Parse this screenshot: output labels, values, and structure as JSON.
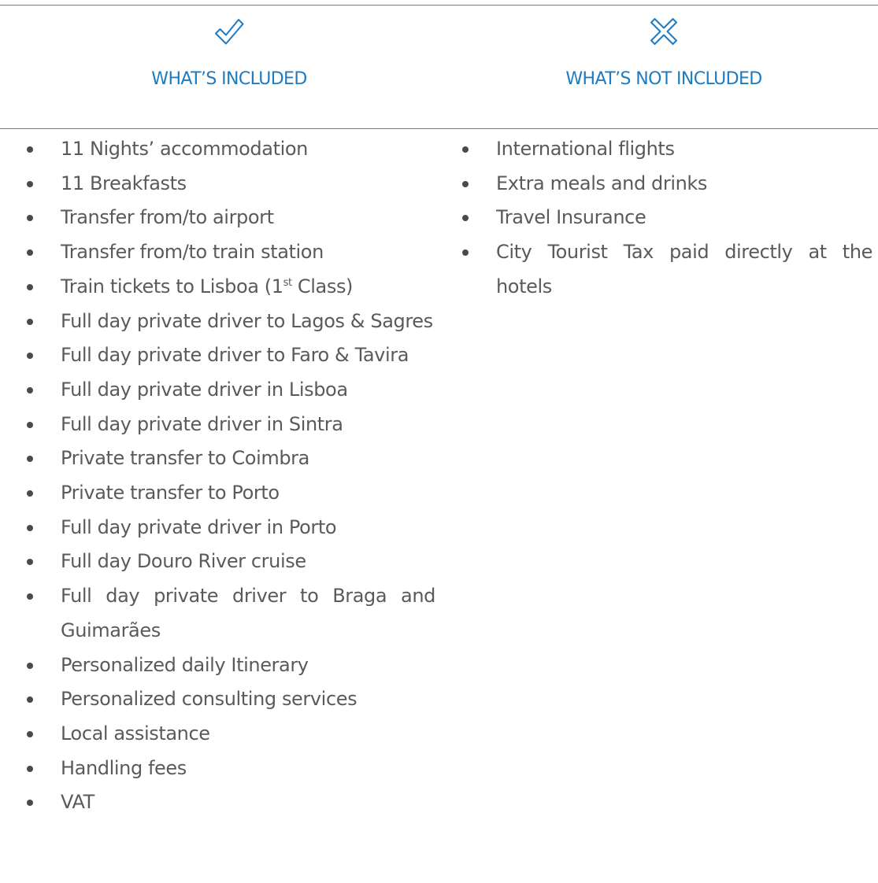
{
  "included": {
    "heading": "WHAT’S INCLUDED",
    "icon": "checkmark-icon",
    "items": [
      {
        "text": "11 Nights’ accommodation"
      },
      {
        "text": "11 Breakfasts"
      },
      {
        "text": "Transfer from/to airport"
      },
      {
        "text": "Transfer from/to train station"
      },
      {
        "text_before": "Train tickets to Lisboa (1",
        "sup": "st",
        "text_after": " Class)"
      },
      {
        "text": "Full day private driver to Lagos & Sagres"
      },
      {
        "text": "Full day private driver to Faro & Tavira"
      },
      {
        "text": "Full day private driver in Lisboa"
      },
      {
        "text": "Full day private driver in Sintra"
      },
      {
        "text": "Private transfer to Coimbra"
      },
      {
        "text": "Private transfer to Porto"
      },
      {
        "text": "Full day private driver in Porto"
      },
      {
        "text": "Full day Douro River cruise"
      },
      {
        "text": "Full day private driver to Braga and Guimarães"
      },
      {
        "text": "Personalized daily Itinerary"
      },
      {
        "text": "Personalized consulting services"
      },
      {
        "text": "Local assistance"
      },
      {
        "text": "Handling fees"
      },
      {
        "text": "VAT"
      }
    ]
  },
  "not_included": {
    "heading": "WHAT’S NOT INCLUDED",
    "icon": "cross-icon",
    "items": [
      {
        "text": "International flights"
      },
      {
        "text": "Extra meals and drinks"
      },
      {
        "text": "Travel Insurance"
      },
      {
        "text": "City Tourist Tax paid directly at the hotels"
      }
    ]
  },
  "colors": {
    "accent": "#1f7bc0",
    "body_text": "#5a5a5a",
    "rule": "#7a7a7a"
  }
}
